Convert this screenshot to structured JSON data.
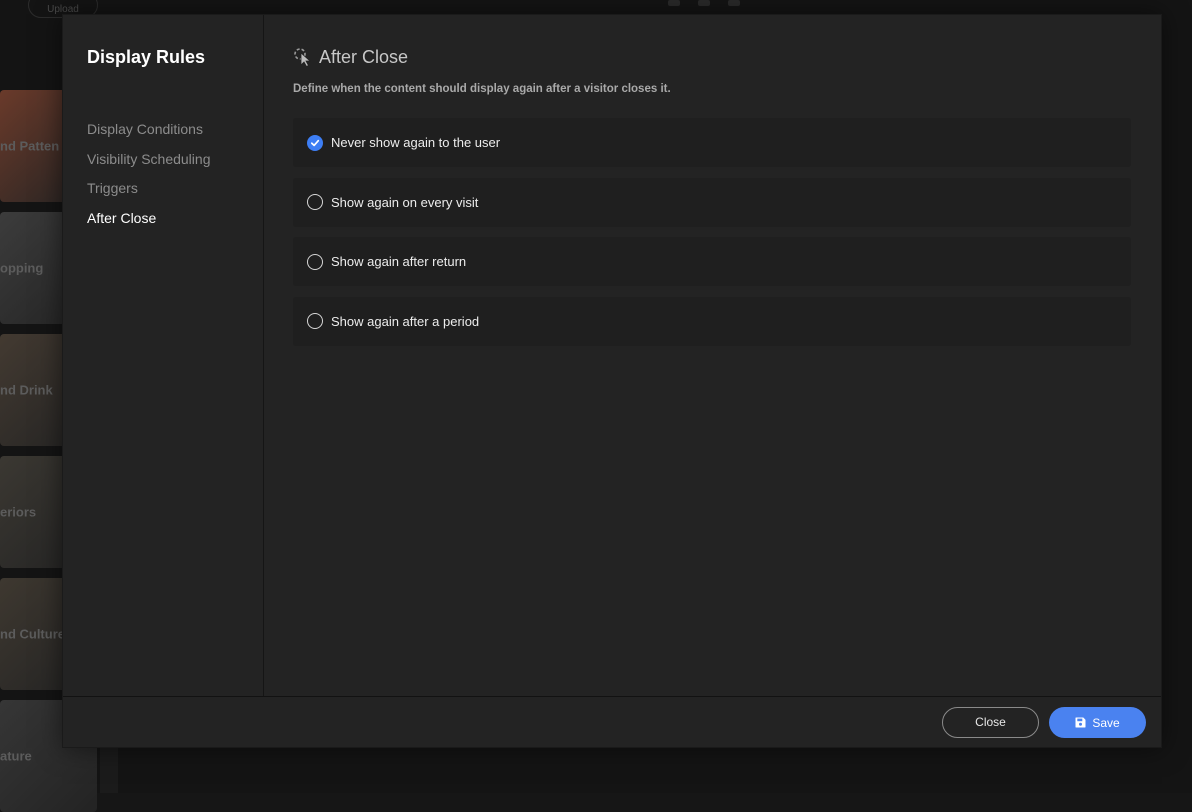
{
  "background": {
    "upload_label": "Upload",
    "cards": [
      {
        "label": "nd Patten",
        "color": "#6a3a2a"
      },
      {
        "label": "opping",
        "color": "#3c3c3c"
      },
      {
        "label": "nd Drink",
        "color": "#433a31"
      },
      {
        "label": "eriors",
        "color": "#3b3832"
      },
      {
        "label": "nd Culture",
        "color": "#3e3830"
      },
      {
        "label": "ature",
        "color": "#363636"
      }
    ]
  },
  "modal": {
    "sidebar": {
      "title": "Display Rules",
      "items": [
        {
          "label": "Display Conditions",
          "active": false
        },
        {
          "label": "Visibility Scheduling",
          "active": false
        },
        {
          "label": "Triggers",
          "active": false
        },
        {
          "label": "After Close",
          "active": true
        }
      ]
    },
    "section": {
      "icon": "pointer-click-icon",
      "title": "After Close",
      "description": "Define when the content should display again after a visitor closes it."
    },
    "options": [
      {
        "label": "Never show again to the user",
        "checked": true
      },
      {
        "label": "Show again on every visit",
        "checked": false
      },
      {
        "label": "Show again after return",
        "checked": false
      },
      {
        "label": "Show again after a period",
        "checked": false
      }
    ],
    "footer": {
      "close_label": "Close",
      "save_label": "Save",
      "save_icon": "save-icon"
    }
  },
  "colors": {
    "accent": "#4a82f0",
    "radio_checked": "#3d7ef4",
    "modal_bg": "#232323",
    "option_bg": "#1f1f1f"
  }
}
